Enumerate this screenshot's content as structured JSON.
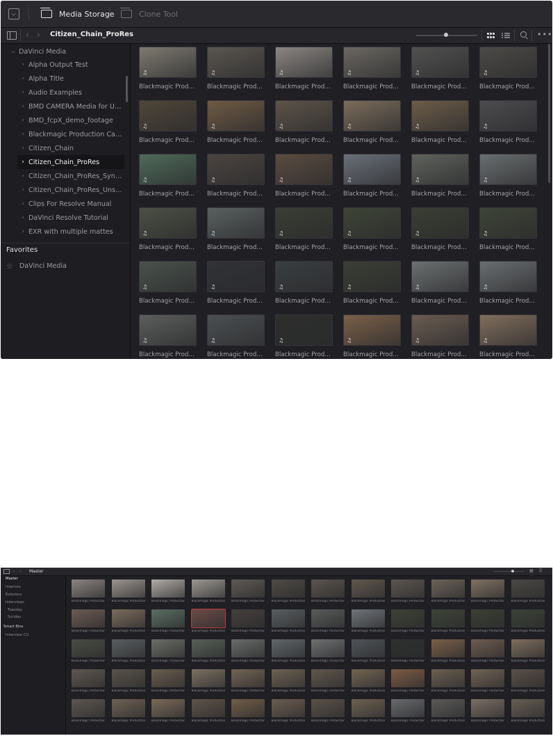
{
  "top": {
    "tabs": [
      {
        "label": "Media Storage",
        "active": true
      },
      {
        "label": "Clone Tool",
        "active": false
      }
    ],
    "breadcrumb": "Citizen_Chain_ProRes",
    "sidebar": {
      "root": "DaVinci Media",
      "items": [
        {
          "label": "Alpha Output Test",
          "selected": false
        },
        {
          "label": "Alpha Title",
          "selected": false
        },
        {
          "label": "Audio Examples",
          "selected": false
        },
        {
          "label": "BMD CAMERA Media for User ...",
          "selected": false
        },
        {
          "label": "BMD_fcpX_demo_footage",
          "selected": false
        },
        {
          "label": "Blackmagic Production Camera...",
          "selected": false
        },
        {
          "label": "Citizen_Chain",
          "selected": false
        },
        {
          "label": "Citizen_Chain_ProRes",
          "selected": true
        },
        {
          "label": "Citizen_Chain_ProRes_Synced",
          "selected": false
        },
        {
          "label": "Citizen_Chain_ProRes_Unsynced",
          "selected": false
        },
        {
          "label": "Clips For Resolve Manual",
          "selected": false
        },
        {
          "label": "DaVinci Resolve Tutorial",
          "selected": false
        },
        {
          "label": "EXR with multiple mattes",
          "selected": false
        }
      ],
      "favorites_heading": "Favorites",
      "favorites": [
        {
          "label": "DaVinci Media"
        }
      ]
    },
    "clip_caption": "Blackmagic Productio...",
    "clip_colors": [
      [
        "#7e7a70",
        "#5a5650",
        "#8a8682",
        "#6b6862",
        "#515150",
        "#4c4a46"
      ],
      [
        "#4e4638",
        "#6e5a44",
        "#5c5448",
        "#7a6c5a",
        "#6c5c48",
        "#4c4c4e"
      ],
      [
        "#4e6a5a",
        "#4a4440",
        "#5a4c40",
        "#6a7078",
        "#5e625c",
        "#6a6e6e"
      ],
      [
        "#4c5044",
        "#5a6060",
        "#3a3e34",
        "#3e4436",
        "#3a3e32",
        "#3e4436"
      ],
      [
        "#4a524c",
        "#303236",
        "#3a3e40",
        "#3a3e34",
        "#6c7070",
        "#6a6e70"
      ],
      [
        "#5c5e5c",
        "#4c5052",
        "#2c2e2c",
        "#7a6048",
        "#6a5c50",
        "#806e5c"
      ]
    ]
  },
  "bottom": {
    "breadcrumb": "Master",
    "sidebar": [
      {
        "label": "Master",
        "type": "sel"
      },
      {
        "label": "Interiors",
        "type": "item"
      },
      {
        "label": "Exteriors",
        "type": "item"
      },
      {
        "label": "Interviews",
        "type": "item"
      },
      {
        "label": "Tuesday",
        "type": "sub"
      },
      {
        "label": "Sunday",
        "type": "sub"
      },
      {
        "label": "Smart Bins",
        "type": "head"
      },
      {
        "label": "Interview CU",
        "type": "item"
      }
    ],
    "clip_caption": "Blackmagic Production C...",
    "clip_colors": [
      [
        "#8a8480",
        "#9a948e",
        "#b0aca6",
        "#9c9892",
        "#5e5a54",
        "#4e4a44",
        "#5a544c",
        "#60584c",
        "#5c5650",
        "#6c6458",
        "#807262",
        "#4a4844"
      ],
      [
        "#6c5c52",
        "#7a6c5c",
        "#5a6e62",
        "#6a4c48",
        "#44403c",
        "#5a5e60",
        "#585c5a",
        "#707478",
        "#3e4236",
        "#3e4438",
        "#3a4034",
        "#3c4238"
      ],
      [
        "#4a4e44",
        "#5a5e5e",
        "#6a6e66",
        "#586058",
        "#686c6a",
        "#62676a",
        "#6e7070",
        "#505458",
        "#2e302e",
        "#7a6048",
        "#6e5c50",
        "#7e6e5e"
      ],
      [
        "#5e5850",
        "#5a544a",
        "#6a5e4e",
        "#7c7060",
        "#726454",
        "#6e6252",
        "#60584e",
        "#726452",
        "#7e5c44",
        "#6c6050",
        "#706454",
        "#5a5048"
      ],
      [
        "#5c5650",
        "#6e6254",
        "#7a6a58",
        "#5e5448",
        "#705e48",
        "#6c5e50",
        "#5a5248",
        "#6e6250",
        "#686a6c",
        "#5c5a58",
        "#7a7064",
        "#665e54"
      ]
    ]
  }
}
